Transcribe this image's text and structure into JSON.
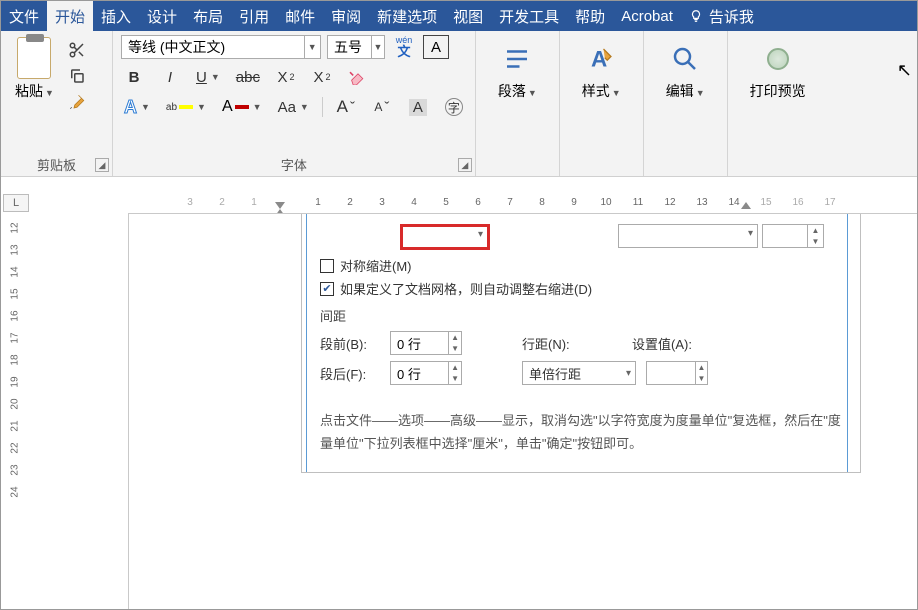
{
  "tabs": {
    "file": "文件",
    "home": "开始",
    "insert": "插入",
    "design": "设计",
    "layout": "布局",
    "references": "引用",
    "mailings": "邮件",
    "review": "审阅",
    "newtab": "新建选项",
    "view": "视图",
    "developer": "开发工具",
    "help": "帮助",
    "acrobat": "Acrobat",
    "tellme": "告诉我"
  },
  "groups": {
    "clipboard": "剪贴板",
    "font": "字体",
    "paragraph": "段落",
    "styles": "样式",
    "editing": "编辑",
    "printpreview": "打印预览"
  },
  "clipboard": {
    "paste": "粘贴"
  },
  "font": {
    "name": "等线 (中文正文)",
    "size": "五号",
    "wen_top": "wén",
    "wen_bot": "文",
    "A": "A"
  },
  "ruler": {
    "h": [
      "3",
      "2",
      "1",
      "",
      "1",
      "2",
      "3",
      "4",
      "5",
      "6",
      "7",
      "8",
      "9",
      "10",
      "11",
      "12",
      "13",
      "14",
      "15",
      "16",
      "17"
    ],
    "v": [
      "12",
      "13",
      "14",
      "15",
      "16",
      "17",
      "18",
      "19",
      "20",
      "21",
      "22",
      "23",
      "24"
    ]
  },
  "dialog": {
    "mirror": "对称缩进(M)",
    "autoadjust": "如果定义了文档网格，则自动调整右缩进(D)",
    "spacing_header": "间距",
    "before_label": "段前(B):",
    "before_value": "0 行",
    "after_label": "段后(F):",
    "after_value": "0 行",
    "linespacing_label": "行距(N):",
    "linespacing_value": "单倍行距",
    "setvalue_label": "设置值(A):",
    "hint": "点击文件——选项——高级——显示，取消勾选\"以字符宽度为度量单位\"复选框，然后在\"度量单位\"下拉列表框中选择\"厘米\"，单击\"确定\"按钮即可。"
  }
}
